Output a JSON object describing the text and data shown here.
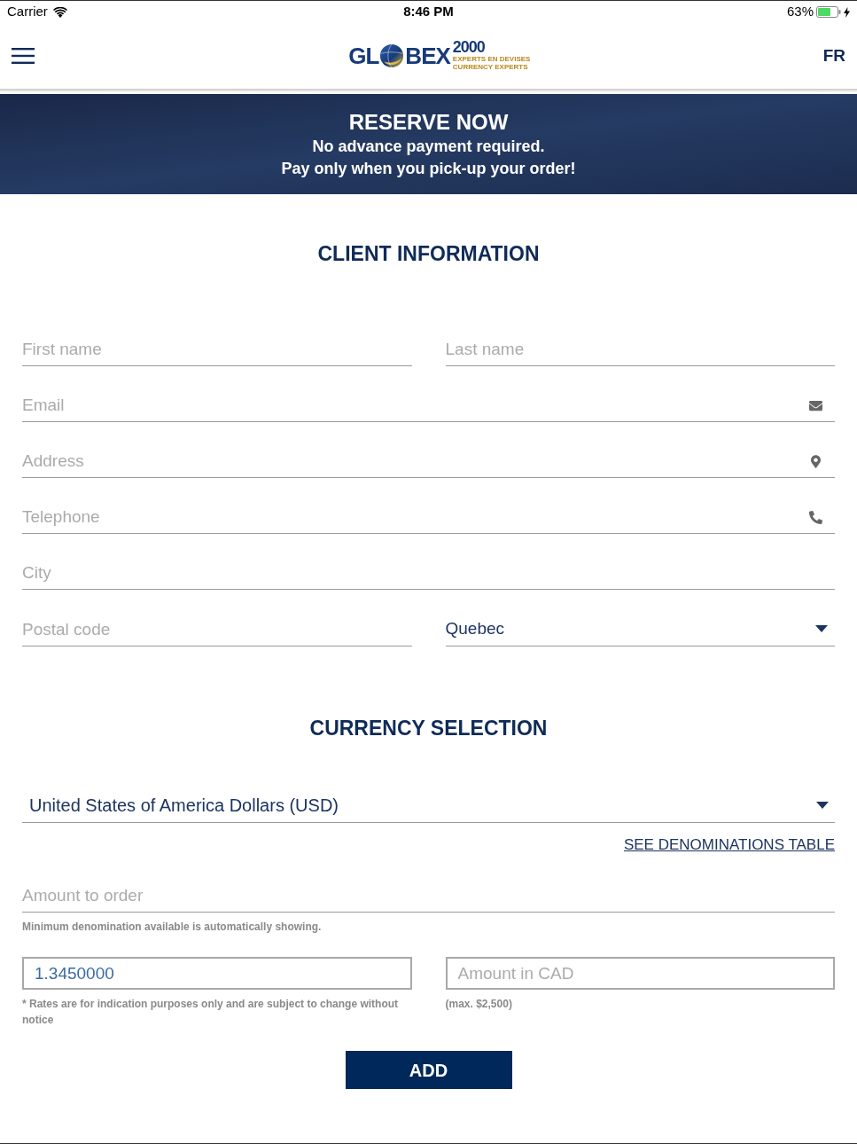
{
  "status_bar": {
    "carrier": "Carrier",
    "time": "8:46 PM",
    "battery": "63%"
  },
  "header": {
    "logo": {
      "text_before": "GL",
      "text_after": "BEX",
      "number": "2000",
      "tagline_1": "EXPERTS EN DEVISES",
      "tagline_2": "CURRENCY EXPERTS"
    },
    "language_button": "FR"
  },
  "banner": {
    "title": "RESERVE NOW",
    "lines": [
      "No advance payment required.",
      "Pay only when you pick-up your order!"
    ]
  },
  "client_information": {
    "title": "CLIENT INFORMATION",
    "rows": [
      [
        {
          "kind": "text",
          "placeholder": "First name"
        },
        {
          "kind": "text",
          "placeholder": "Last name"
        }
      ],
      [
        {
          "kind": "email",
          "placeholder": "Email"
        }
      ],
      [
        {
          "kind": "address",
          "placeholder": "Address"
        }
      ],
      [
        {
          "kind": "phone",
          "placeholder": "Telephone"
        }
      ],
      [
        {
          "kind": "text",
          "placeholder": "City"
        }
      ],
      [
        {
          "kind": "text",
          "placeholder": "Postal code"
        },
        {
          "kind": "select",
          "value": "Quebec"
        }
      ]
    ]
  },
  "currency_selection": {
    "title": "CURRENCY SELECTION",
    "currency_select": {
      "value": "United States of America Dollars (USD)"
    },
    "denominations_link": "SEE DENOMINATIONS TABLE",
    "amount_field": {
      "placeholder": "Amount to order"
    },
    "amount_note": "Minimum denomination available is automatically showing.",
    "rate_field": {
      "value": "1.3450000"
    },
    "rate_note": "* Rates are for indication purposes only and are subject to change without notice",
    "cad_field": {
      "placeholder": "Amount in CAD"
    },
    "cad_note": "(max. $2,500)",
    "add_button": "ADD"
  }
}
